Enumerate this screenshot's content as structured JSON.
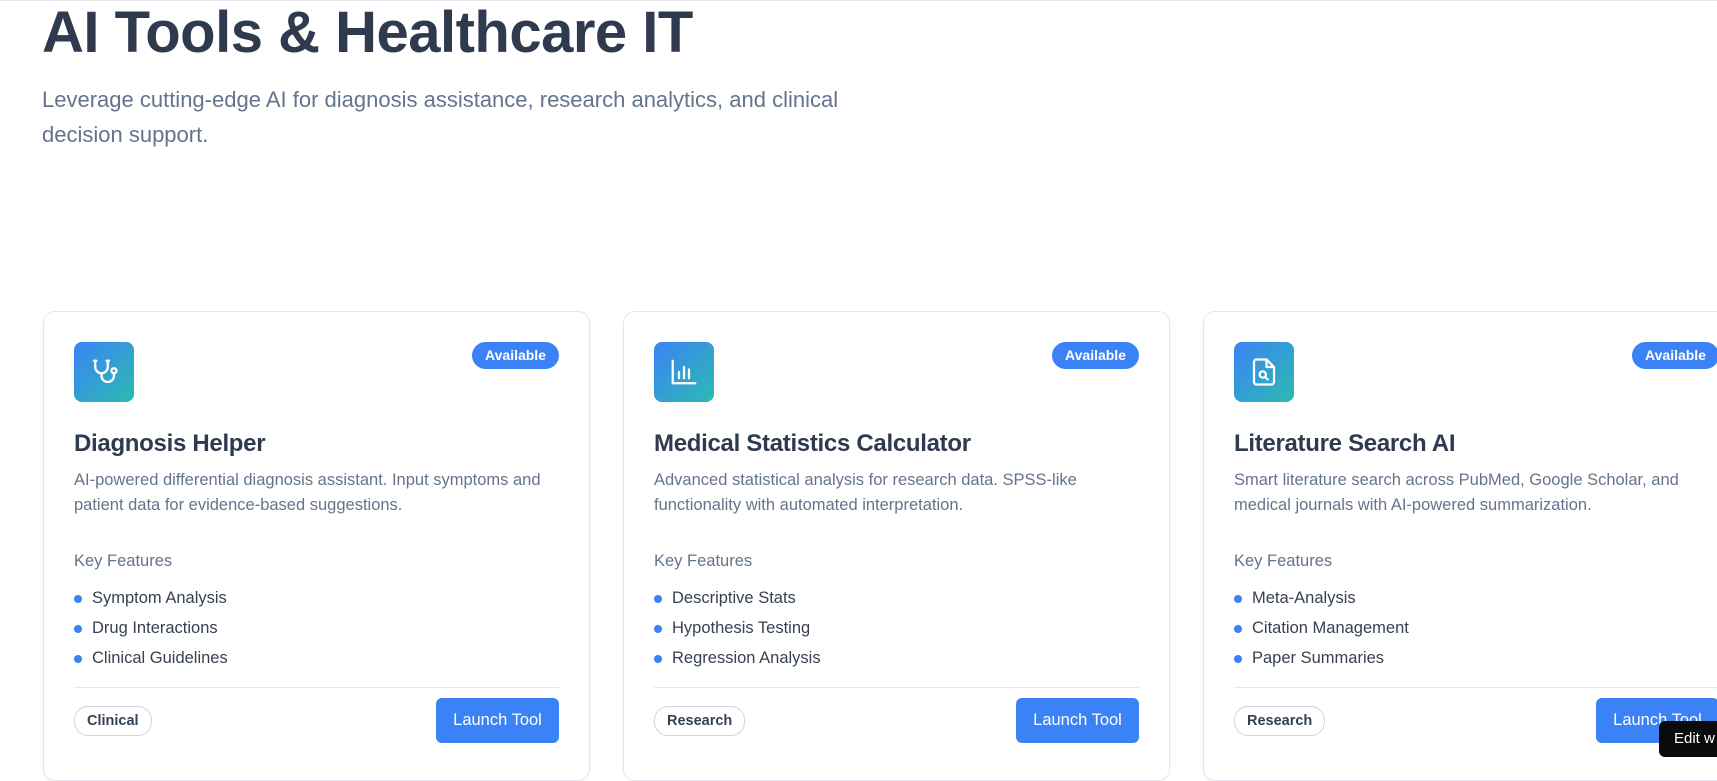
{
  "hero": {
    "title": "AI Tools & Healthcare IT",
    "subtitle": "Leverage cutting-edge AI for diagnosis assistance, research analytics, and clinical decision support."
  },
  "cards": [
    {
      "icon": "stethoscope-icon",
      "badge": "Available",
      "title": "Diagnosis Helper",
      "description": "AI-powered differential diagnosis assistant. Input symptoms and patient data for evidence-based suggestions.",
      "features_label": "Key Features",
      "features": [
        "Symptom Analysis",
        "Drug Interactions",
        "Clinical Guidelines"
      ],
      "tag": "Clinical",
      "button": "Launch Tool"
    },
    {
      "icon": "bar-chart-icon",
      "badge": "Available",
      "title": "Medical Statistics Calculator",
      "description": "Advanced statistical analysis for research data. SPSS-like functionality with automated interpretation.",
      "features_label": "Key Features",
      "features": [
        "Descriptive Stats",
        "Hypothesis Testing",
        "Regression Analysis"
      ],
      "tag": "Research",
      "button": "Launch Tool"
    },
    {
      "icon": "file-search-icon",
      "badge": "Available",
      "title": "Literature Search AI",
      "description": "Smart literature search across PubMed, Google Scholar, and medical journals with AI-powered summarization.",
      "features_label": "Key Features",
      "features": [
        "Meta-Analysis",
        "Citation Management",
        "Paper Summaries"
      ],
      "tag": "Research",
      "button": "Launch Tool"
    }
  ],
  "edit_widget": {
    "label": "Edit w"
  },
  "colors": {
    "accent": "#3b82f6",
    "gradient_end": "#2bbbb0",
    "heading": "#2f3a4e",
    "muted": "#64748b"
  }
}
